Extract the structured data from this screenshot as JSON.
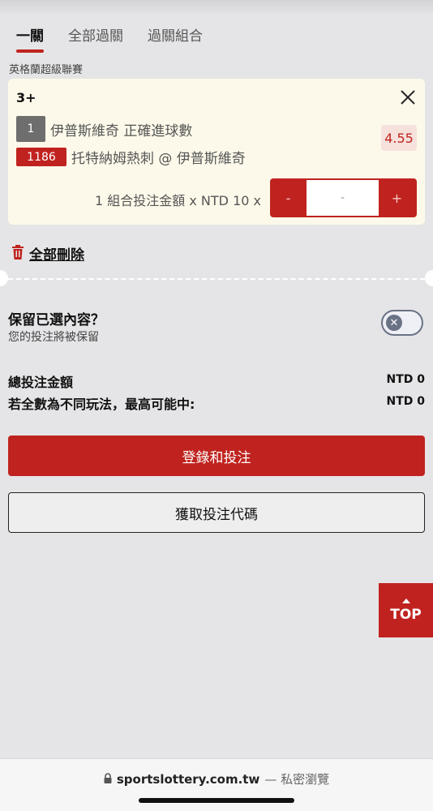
{
  "tabs": [
    {
      "label": "一關",
      "active": true
    },
    {
      "label": "全部過關",
      "active": false
    },
    {
      "label": "過關組合",
      "active": false
    }
  ],
  "league": "英格蘭超級聯賽",
  "bet_card": {
    "title": "3+",
    "selection_number": "1",
    "selection_text": "伊普斯維奇 正確進球數",
    "match_number": "1186",
    "match_text": "托特納姆熱刺 @ 伊普斯維奇",
    "odds": "4.55",
    "stake_label": "1 組合投注金額 x NTD 10 x",
    "stake_value": "-",
    "minus_label": "-",
    "plus_label": "+",
    "close_icon": "close-icon"
  },
  "delete_all_label": "全部刪除",
  "keep": {
    "title": "保留已選內容？",
    "subtitle": "您的投注將被保留",
    "toggle_on": false,
    "toggle_glyph": "✕"
  },
  "summary": {
    "total_label": "總投注金額",
    "total_value": "NTD 0",
    "max_label": "若全數為不同玩法，最高可能中:",
    "max_value": "NTD 0"
  },
  "buttons": {
    "login_bet": "登錄和投注",
    "get_code": "獲取投注代碼",
    "top": "TOP"
  },
  "browser": {
    "domain": "sportslottery.com.tw",
    "suffix": "— 私密瀏覽"
  },
  "colors": {
    "accent": "#c0231f",
    "card_bg": "#fdf9ea",
    "page_bg": "#e5e5e7"
  }
}
